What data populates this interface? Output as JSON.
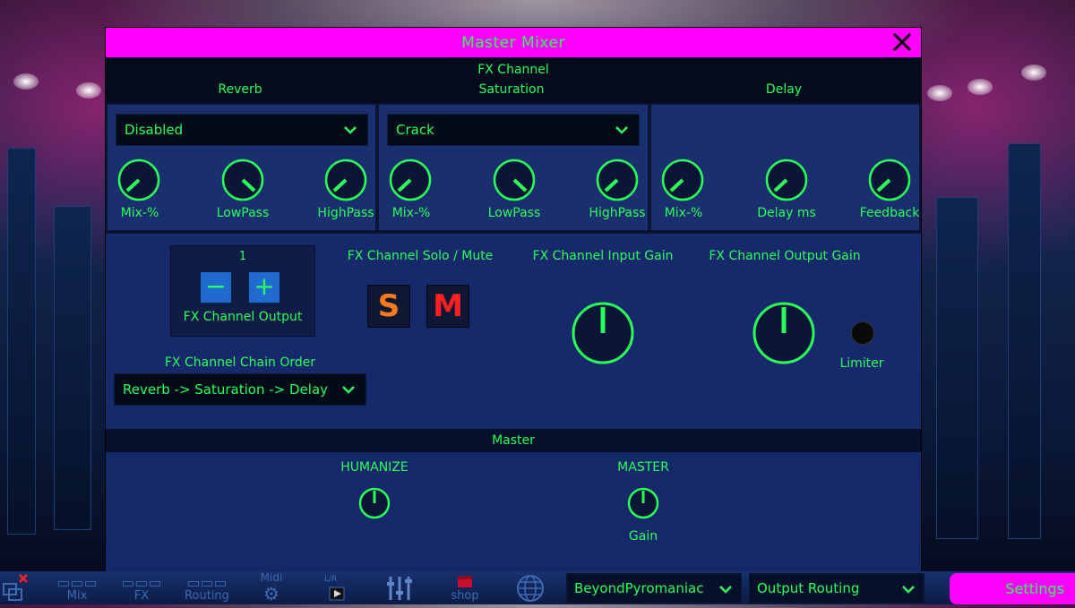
{
  "window": {
    "title": "Master Mixer",
    "close_glyph": "✕"
  },
  "fx_channel": {
    "header": "FX Channel",
    "reverb": {
      "title": "Reverb",
      "preset": "Disabled",
      "knobs": [
        "Mix-%",
        "LowPass",
        "HighPass"
      ]
    },
    "saturation": {
      "title": "Saturation",
      "preset": "Crack",
      "knobs": [
        "Mix-%",
        "LowPass",
        "HighPass"
      ]
    },
    "delay": {
      "title": "Delay",
      "knobs": [
        "Mix-%",
        "Delay ms",
        "Feedback"
      ]
    },
    "output": {
      "number": "1",
      "minus": "−",
      "plus": "+",
      "label": "FX Channel Output"
    },
    "chain_order": {
      "label": "FX Channel Chain Order",
      "value": "Reverb -> Saturation -> Delay"
    },
    "solo_mute": {
      "label": "FX Channel Solo / Mute",
      "solo": "S",
      "mute": "M"
    },
    "input_gain_label": "FX Channel Input Gain",
    "output_gain_label": "FX Channel Output Gain",
    "limiter_label": "Limiter"
  },
  "master": {
    "header": "Master",
    "humanize_label": "HUMANIZE",
    "master_label": "MASTER",
    "gain_label": "Gain"
  },
  "toolbar": {
    "items": [
      {
        "label": "Mix",
        "icon": "mix-icon"
      },
      {
        "label": "FX",
        "icon": "fx-icon"
      },
      {
        "label": "Routing",
        "icon": "routing-icon"
      },
      {
        "label": "Midi",
        "icon": "gear-icon"
      },
      {
        "label": "",
        "icon": "lyrics-icon"
      },
      {
        "label": "",
        "icon": "sliders-icon"
      },
      {
        "label": "shop",
        "icon": "shop-icon"
      },
      {
        "label": "",
        "icon": "globe-icon"
      }
    ],
    "song_select": "BeyondPyromaniac",
    "output_routing": "Output Routing",
    "settings": "Settings"
  },
  "colors": {
    "accent_magenta": "#ff00ff",
    "text_green": "#2bff5a",
    "solo_orange": "#ff7a1a",
    "mute_red": "#ff2020"
  }
}
